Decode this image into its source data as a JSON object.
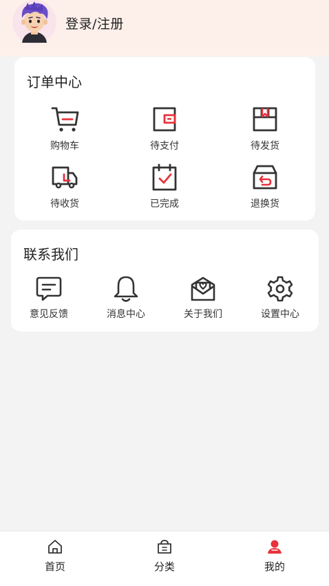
{
  "header": {
    "login_label": "登录/注册",
    "bg_color": "#fdf0ea"
  },
  "orders": {
    "title": "订单中心",
    "items": [
      {
        "label": "购物车",
        "icon": "cart-icon"
      },
      {
        "label": "待支付",
        "icon": "wallet-icon"
      },
      {
        "label": "待发货",
        "icon": "package-icon"
      },
      {
        "label": "待收货",
        "icon": "truck-icon"
      },
      {
        "label": "已完成",
        "icon": "calendar-check-icon"
      },
      {
        "label": "退换货",
        "icon": "return-box-icon"
      }
    ]
  },
  "contact": {
    "title": "联系我们",
    "items": [
      {
        "label": "意见反馈",
        "icon": "feedback-icon"
      },
      {
        "label": "消息中心",
        "icon": "bell-icon"
      },
      {
        "label": "关于我们",
        "icon": "envelope-heart-icon"
      },
      {
        "label": "设置中心",
        "icon": "gear-icon"
      }
    ]
  },
  "tabbar": {
    "tabs": [
      {
        "label": "首页",
        "icon": "home-icon",
        "active": false
      },
      {
        "label": "分类",
        "icon": "basket-icon",
        "active": false
      },
      {
        "label": "我的",
        "icon": "user-icon",
        "active": true
      }
    ]
  },
  "colors": {
    "accent": "#e8323c",
    "icon_dark": "#333333",
    "background": "#f3f3f3"
  }
}
